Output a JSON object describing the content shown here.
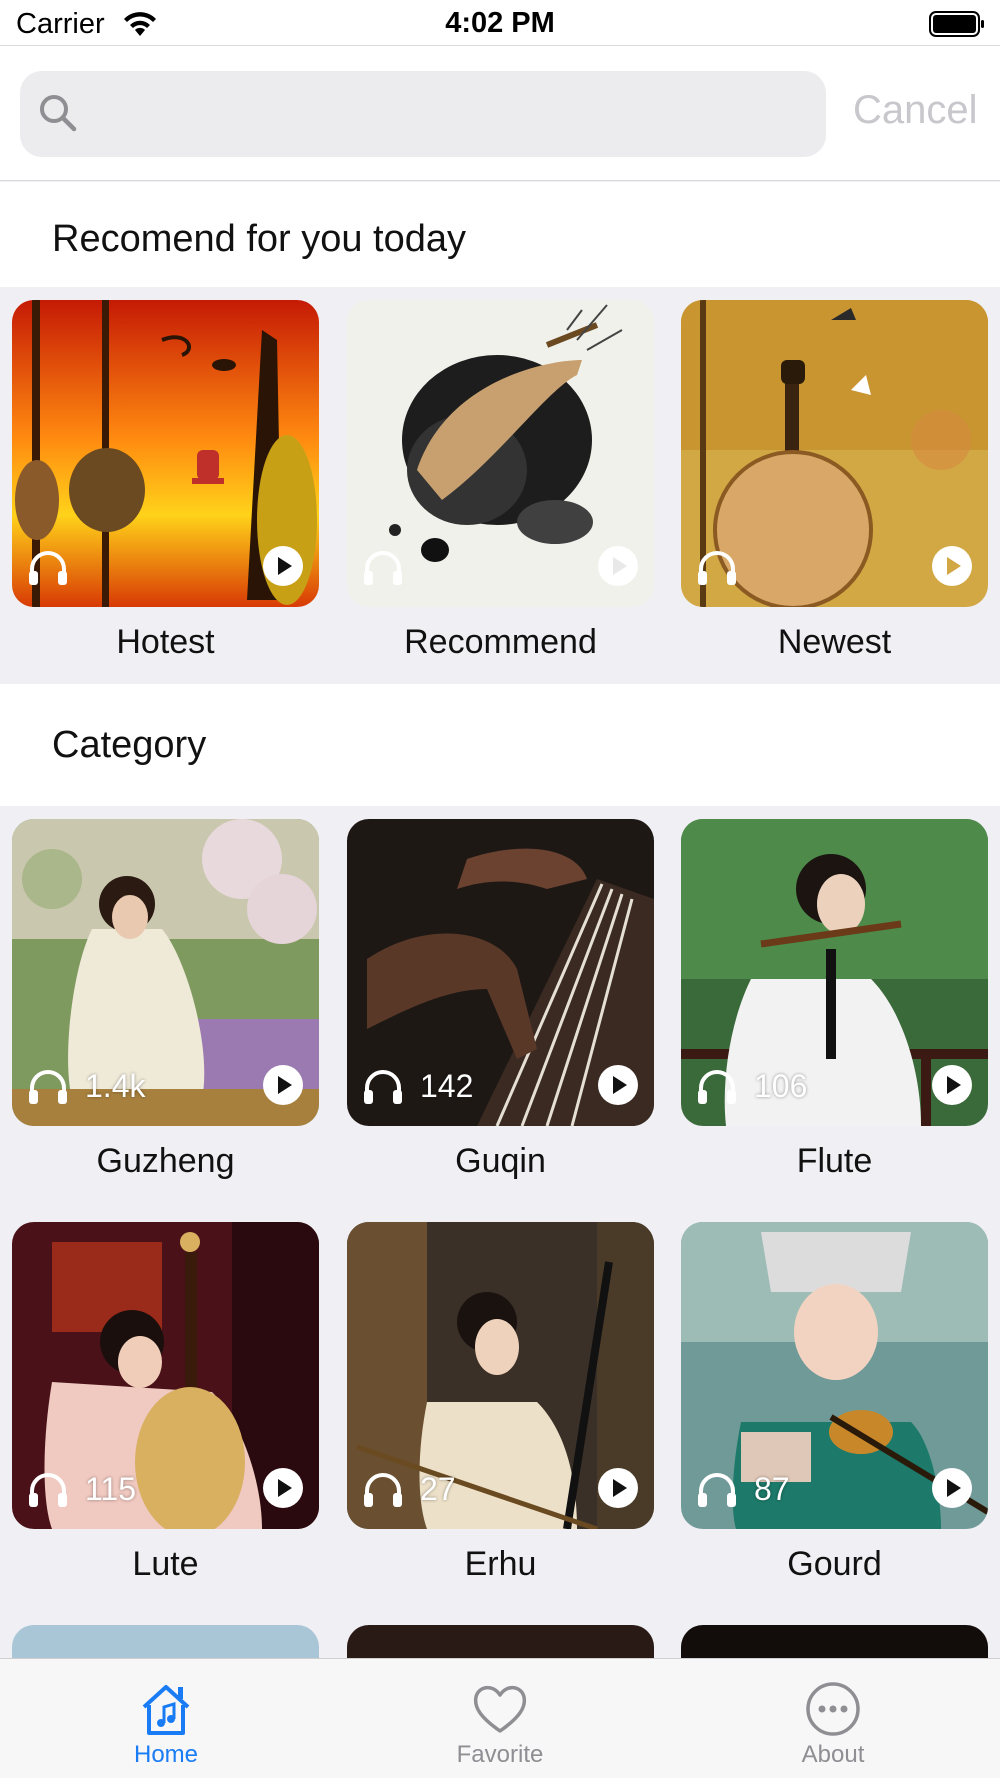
{
  "status_bar": {
    "carrier": "Carrier",
    "time": "4:02 PM"
  },
  "search": {
    "value": "",
    "placeholder": "",
    "cancel_label": "Cancel"
  },
  "recommend": {
    "title": "Recomend for you today",
    "items": [
      {
        "label": "Hotest",
        "art": "orange-sunset-instruments"
      },
      {
        "label": "Recommend",
        "art": "ink-wash-pipa"
      },
      {
        "label": "Newest",
        "art": "yellow-ruan"
      }
    ]
  },
  "category": {
    "title": "Category",
    "items": [
      {
        "label": "Guzheng",
        "count": "1.4k"
      },
      {
        "label": "Guqin",
        "count": "142"
      },
      {
        "label": "Flute",
        "count": "106"
      },
      {
        "label": "Lute",
        "count": "115"
      },
      {
        "label": "Erhu",
        "count": "27"
      },
      {
        "label": "Gourd",
        "count": "87"
      }
    ]
  },
  "tab_bar": {
    "items": [
      {
        "label": "Home",
        "icon": "home-music-icon",
        "active": true
      },
      {
        "label": "Favorite",
        "icon": "heart-icon",
        "active": false
      },
      {
        "label": "About",
        "icon": "ellipsis-circle-icon",
        "active": false
      }
    ]
  },
  "colors": {
    "accent": "#1a7cf5",
    "inactive": "#8e8e93",
    "background": "#efeff4"
  }
}
